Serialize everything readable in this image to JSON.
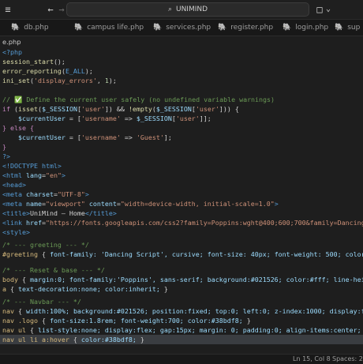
{
  "titlebar": {
    "menu_icon": "≡",
    "back_icon": "←",
    "forward_icon": "→",
    "search_text": "UNIMIND",
    "layout_icon": "□",
    "chevron_icon": "⌄"
  },
  "tabs": [
    {
      "label": "db.php"
    },
    {
      "label": "campus life.php"
    },
    {
      "label": "services.php"
    },
    {
      "label": "register.php"
    },
    {
      "label": "login.php"
    },
    {
      "label": "sup"
    }
  ],
  "editor": {
    "filename": "e.php",
    "lines": {
      "l1": "<?php",
      "l2_fn": "session_start",
      "l2_rest": "();",
      "l3_fn": "error_reporting",
      "l3_arg": "E_ALL",
      "l4_fn": "ini_set",
      "l4_str": "'display_errors'",
      "l4_num": "1",
      "c1_slashes": "// ",
      "c1_check": "✅",
      "c1_text": " Define the current user safely (no undefined variable warnings)",
      "if_kw": "if",
      "isset_fn": "isset",
      "session_var": "$_SESSION",
      "user_key": "'user'",
      "empty_fn": "!empty",
      "cu_var": "$currentUser",
      "username_key": "'username'",
      "guest_val": "'Guest'",
      "else_kw": "} else {",
      "close_brace": "}",
      "php_close": "?>",
      "doctype_text": "<!DOCTYPE html>",
      "html_open": "<html",
      "lang_attr": "lang",
      "lang_val": "\"en\"",
      "head_open": "<head>",
      "meta_charset": "charset",
      "meta_charset_val": "\"UTF-8\"",
      "meta_name": "name",
      "meta_name_val": "\"viewport\"",
      "meta_content": "content",
      "meta_content_val": "\"width=device-width, initial-scale=1.0\"",
      "title_text": "UniMind – Home",
      "link_href": "href",
      "link_href_val": "\"https://fonts.googleapis.com/css2?family=Poppins:wght@400;600;700&family=Dancing",
      "style_open": "<style>",
      "c2": "/* --- greeting --- */",
      "greeting_sel": "#greeting",
      "greeting_body": "font-family: 'Dancing Script', cursive; font-size: 40px; font-weight: 500; color:",
      "c3": "/* --- Reset & base --- */",
      "body_sel": "body",
      "body_decl": "margin:0; font-family:'Poppins', sans-serif; background:#021526; color:#fff; line-heig",
      "a_sel": "a",
      "a_decl": "text-decoration:none; color:inherit;",
      "c4": "/* --- Navbar --- */",
      "nav_sel": "nav",
      "nav_decl": "width:100%; background:#021526; position:fixed; top:0; left:0; z-index:1000; display:f",
      "logo_sel": "nav .logo",
      "logo_decl": "font-size:1.8rem; font-weight:700; color:#38bdf8;",
      "ul_sel": "nav ul",
      "ul_decl": "list-style:none; display:flex; gap:15px; margin: 0; padding:0; align-items:center;",
      "hover_sel": "nav ul li a:hover",
      "hover_decl": "color:#38bdf8;"
    }
  },
  "statusbar": {
    "position": "Ln 15, Col 8",
    "spaces": "Spaces: 2"
  }
}
